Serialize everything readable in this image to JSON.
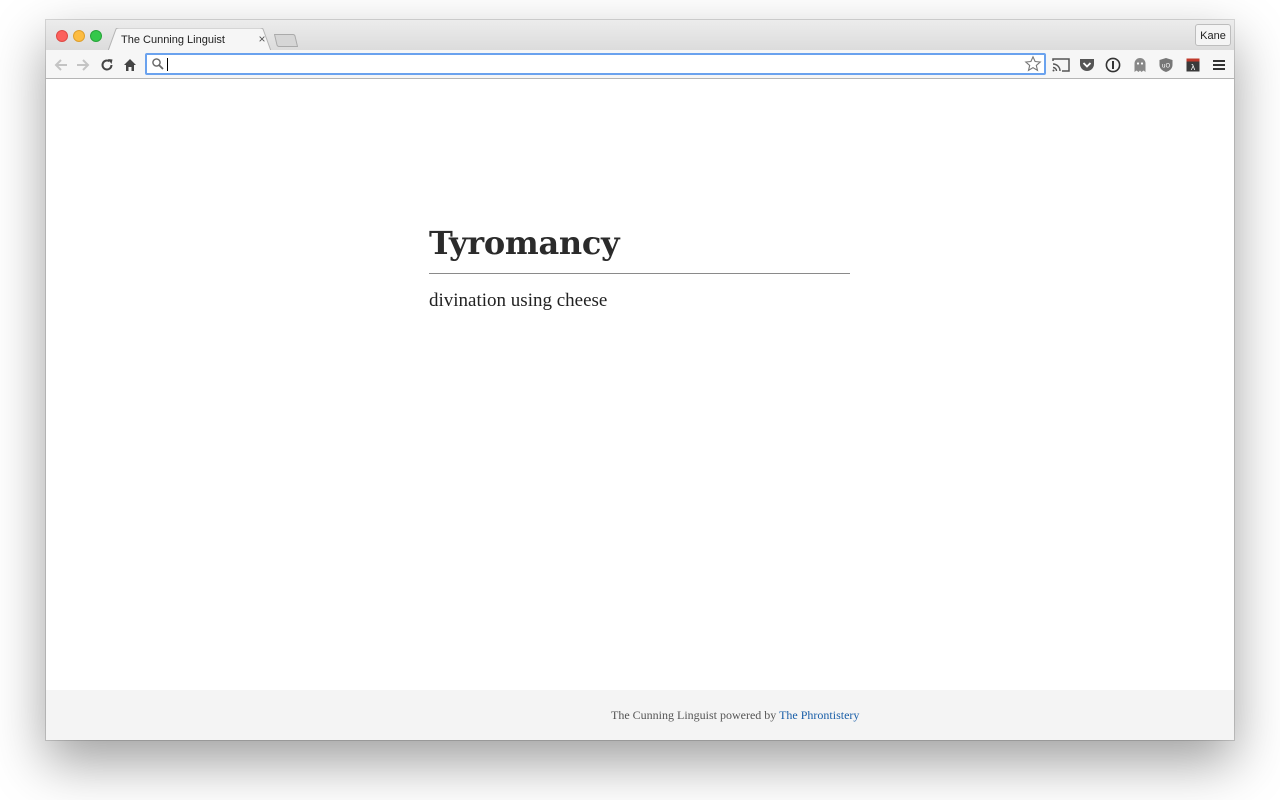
{
  "browser": {
    "tab": {
      "title": "The Cunning Linguist",
      "close_glyph": "×"
    },
    "profile_name": "Kane",
    "omnibox": {
      "value": "",
      "placeholder": ""
    },
    "accent_color": "#6aa2ee",
    "toolbar_icons": [
      "back-icon",
      "forward-icon",
      "reload-icon",
      "home-icon",
      "search-icon",
      "star-icon",
      "cast-icon",
      "pocket-icon",
      "1password-icon",
      "ghostery-icon",
      "ublock-icon",
      "extension-icon",
      "menu-icon"
    ]
  },
  "page": {
    "title": "Tyromancy",
    "definition": "divination using cheese"
  },
  "footer": {
    "prefix": "The Cunning Linguist powered by ",
    "link_text": "The Phrontistery",
    "link_color": "#1a5fa8"
  }
}
